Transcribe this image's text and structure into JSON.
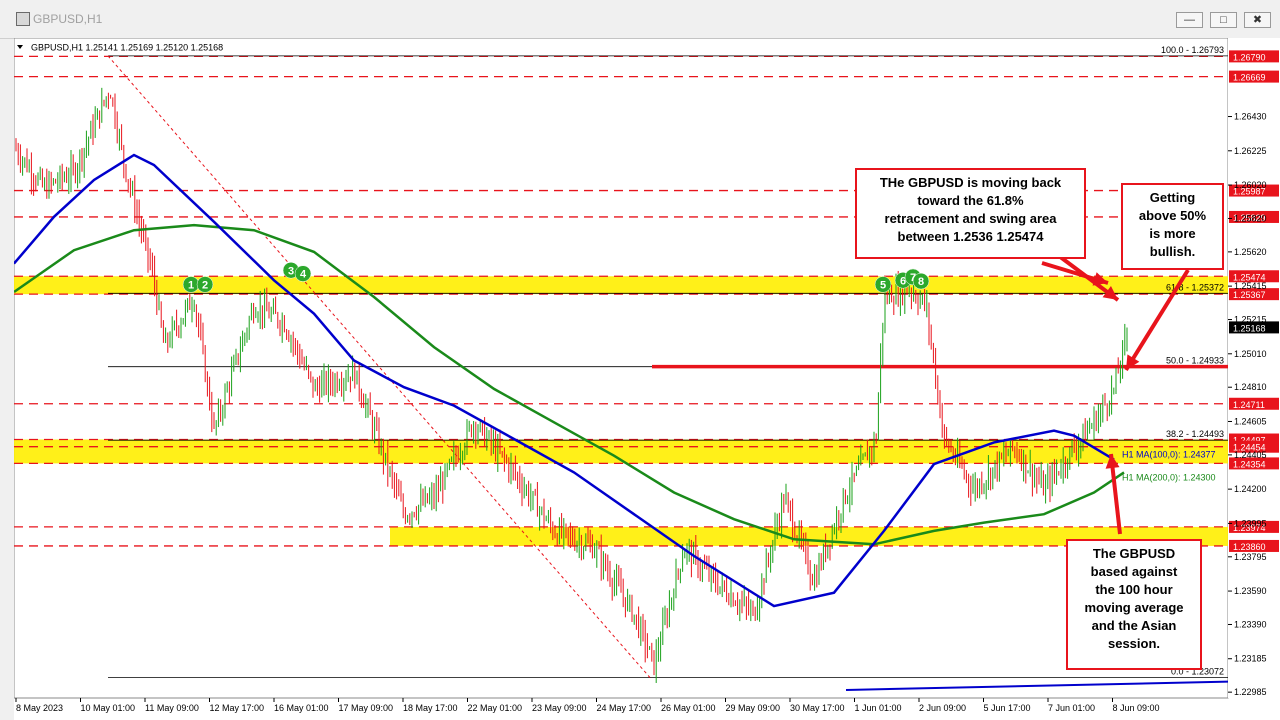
{
  "window": {
    "title": "GBPUSD,H1",
    "buttons": [
      "―",
      "□",
      "✖"
    ]
  },
  "chart_data": {
    "type": "candlestick",
    "header": "GBPUSD,H1  1.25141 1.25169 1.25120 1.25168",
    "symbol": "GBPUSD",
    "timeframe": "H1",
    "ohlc": {
      "open": 1.25141,
      "high": 1.25169,
      "low": 1.2512,
      "close": 1.25168
    },
    "ylim": [
      1.2295,
      1.269
    ],
    "y_ticks": [
      1.2643,
      1.26225,
      1.2602,
      1.2582,
      1.2562,
      1.25415,
      1.25215,
      1.2501,
      1.2481,
      1.24605,
      1.24405,
      1.242,
      1.23995,
      1.23795,
      1.2359,
      1.2339,
      1.23185,
      1.22985
    ],
    "x_labels": [
      "8 May 2023",
      "10 May 01:00",
      "11 May 09:00",
      "12 May 17:00",
      "16 May 01:00",
      "17 May 09:00",
      "18 May 17:00",
      "22 May 01:00",
      "23 May 09:00",
      "24 May 17:00",
      "26 May 01:00",
      "29 May 09:00",
      "30 May 17:00",
      "1 Jun 01:00",
      "2 Jun 09:00",
      "5 Jun 17:00",
      "7 Jun 01:00",
      "8 Jun 09:00"
    ],
    "series": [
      {
        "name": "H1 MA(100,0)",
        "color": "#0000cc",
        "current": 1.24377
      },
      {
        "name": "H1 MA(200,0)",
        "color": "#1a8a1a",
        "current": 1.243
      }
    ],
    "fib_levels": [
      {
        "label": "100.0 - 1.26793",
        "value": 1.26793
      },
      {
        "label": "61.8 - 1.25372",
        "value": 1.25372
      },
      {
        "label": "50.0 - 1.24933",
        "value": 1.24933
      },
      {
        "label": "38.2 - 1.24493",
        "value": 1.24493
      },
      {
        "label": "0.0 - 1.23072",
        "value": 1.23072
      }
    ],
    "price_labels": [
      {
        "text": "1.26790",
        "value": 1.2679,
        "color": "#e8141c"
      },
      {
        "text": "1.26669",
        "value": 1.26669,
        "color": "#e8141c"
      },
      {
        "text": "1.25987",
        "value": 1.25987,
        "color": "#e8141c"
      },
      {
        "text": "1.25829",
        "value": 1.25829,
        "color": "#e8141c"
      },
      {
        "text": "1.25474",
        "value": 1.25474,
        "color": "#e8141c"
      },
      {
        "text": "1.25367",
        "value": 1.25367,
        "color": "#e8141c"
      },
      {
        "text": "1.25168",
        "value": 1.25168,
        "color": "#000000"
      },
      {
        "text": "1.24711",
        "value": 1.24711,
        "color": "#e8141c"
      },
      {
        "text": "1.24497",
        "value": 1.24497,
        "color": "#e8141c"
      },
      {
        "text": "1.24454",
        "value": 1.24454,
        "color": "#e8141c"
      },
      {
        "text": "1.24354",
        "value": 1.24354,
        "color": "#e8141c"
      },
      {
        "text": "1.23974",
        "value": 1.23974,
        "color": "#e8141c"
      },
      {
        "text": "1.23860",
        "value": 1.2386,
        "color": "#e8141c"
      }
    ],
    "swing_markers": [
      "1",
      "2",
      "3",
      "4",
      "5",
      "6",
      "7",
      "8"
    ],
    "annotations": [
      "THe GBPUSD is moving back toward the 61.8% retracement and swing area between 1.2536 1.25474",
      "Getting above 50% is more bullish.",
      "The GBPUSD based against the 100 hour moving average and the Asian session."
    ],
    "colors": {
      "yellow_zone": "#ffee00",
      "red_level": "#e8141c",
      "candle_up": "#1aa01a",
      "candle_down": "#e8141c"
    }
  }
}
